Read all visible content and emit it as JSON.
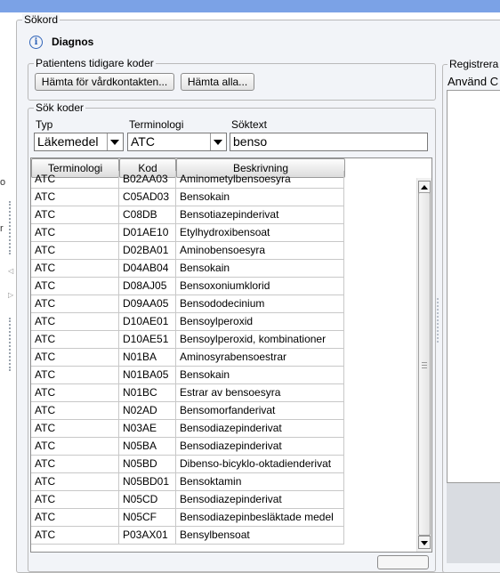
{
  "sections": {
    "sokord": "Sökord",
    "diagnos": "Diagnos",
    "tidigare": "Patientens tidigare koder",
    "sok": "Sök koder",
    "registrera": "Registrera"
  },
  "buttons": {
    "hamta_vard": "Hämta för vårdkontakten...",
    "hamta_alla": "Hämta alla..."
  },
  "fields": {
    "typ_label": "Typ",
    "typ_value": "Läkemedel",
    "terminologi_label": "Terminologi",
    "terminologi_value": "ATC",
    "soktext_label": "Söktext",
    "soktext_value": "benso"
  },
  "right": {
    "text": "Använd C"
  },
  "left_fragments": [
    "o",
    "r"
  ],
  "table": {
    "headers": [
      "Terminologi",
      "Kod",
      "Beskrivning"
    ],
    "rows": [
      [
        "ATC",
        "B02AA03",
        "Aminometylbensoesyra"
      ],
      [
        "ATC",
        "C05AD03",
        "Bensokain"
      ],
      [
        "ATC",
        "C08DB",
        "Bensotiazepinderivat"
      ],
      [
        "ATC",
        "D01AE10",
        "Etylhydroxibensoat"
      ],
      [
        "ATC",
        "D02BA01",
        "Aminobensoesyra"
      ],
      [
        "ATC",
        "D04AB04",
        "Bensokain"
      ],
      [
        "ATC",
        "D08AJ05",
        "Bensoxoniumklorid"
      ],
      [
        "ATC",
        "D09AA05",
        "Bensododecinium"
      ],
      [
        "ATC",
        "D10AE01",
        "Bensoylperoxid"
      ],
      [
        "ATC",
        "D10AE51",
        "Bensoylperoxid, kombinationer"
      ],
      [
        "ATC",
        "N01BA",
        "Aminosyrabensoestrar"
      ],
      [
        "ATC",
        "N01BA05",
        "Bensokain"
      ],
      [
        "ATC",
        "N01BC",
        "Estrar av bensoesyra"
      ],
      [
        "ATC",
        "N02AD",
        "Bensomorfanderivat"
      ],
      [
        "ATC",
        "N03AE",
        "Bensodiazepinderivat"
      ],
      [
        "ATC",
        "N05BA",
        "Bensodiazepinderivat"
      ],
      [
        "ATC",
        "N05BD",
        "Dibenso-bicyklo-oktadienderivat"
      ],
      [
        "ATC",
        "N05BD01",
        "Bensoktamin"
      ],
      [
        "ATC",
        "N05CD",
        "Bensodiazepinderivat"
      ],
      [
        "ATC",
        "N05CF",
        "Bensodiazepinbesläktade medel"
      ],
      [
        "ATC",
        "P03AX01",
        "Bensylbensoat"
      ]
    ]
  }
}
